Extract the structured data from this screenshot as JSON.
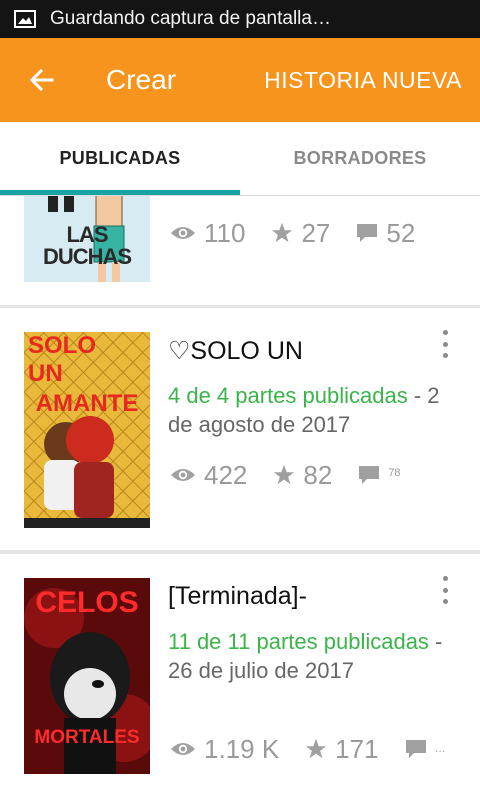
{
  "status_bar": {
    "text": "Guardando captura de pantalla…",
    "icon": "image-icon"
  },
  "app_bar": {
    "back_icon": "arrow-left-icon",
    "title": "Crear",
    "action": "HISTORIA NUEVA",
    "color": "#f7941d"
  },
  "tabs": [
    {
      "label": "PUBLICADAS",
      "active": true
    },
    {
      "label": "BORRADORES",
      "active": false
    }
  ],
  "accent_color": "#1aa3a3",
  "stories": [
    {
      "cover_text": [
        "LAS DUCHAS"
      ],
      "views": "110",
      "stars": "27",
      "comments": "52"
    },
    {
      "title": "♡SOLO UN",
      "cover_text": [
        "SOLO",
        "UN",
        "AMANTE"
      ],
      "parts": "4 de 4 partes publicadas",
      "separator": " - ",
      "date": "2 de agosto de 2017",
      "views": "422",
      "stars": "82",
      "comments": "78"
    },
    {
      "title": "[Terminada]-",
      "cover_text": [
        "CELOS",
        "MORTALES"
      ],
      "parts": "11 de 11 partes publicadas",
      "separator": " - ",
      "date": "26 de julio de 2017",
      "views": "1.19 K",
      "stars": "171",
      "comments": "…"
    }
  ]
}
